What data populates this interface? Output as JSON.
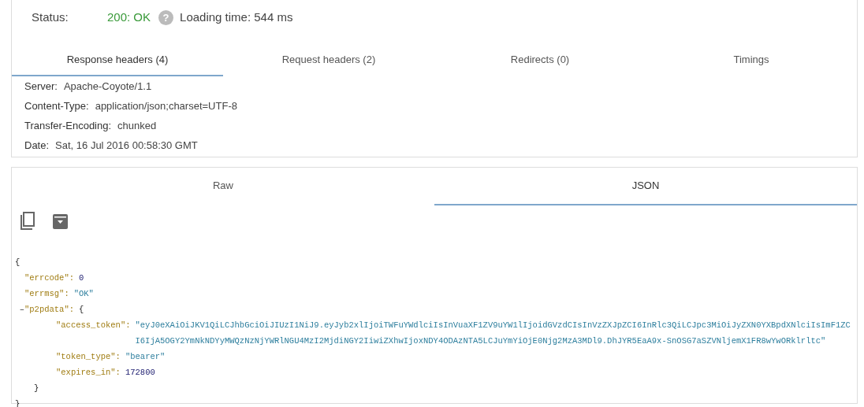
{
  "status": {
    "label": "Status:",
    "code": "200: OK",
    "help_icon": "?",
    "loading_time": "Loading time: 544 ms"
  },
  "header_tabs": [
    {
      "label": "Response headers (4)",
      "selected": true
    },
    {
      "label": "Request headers (2)",
      "selected": false
    },
    {
      "label": "Redirects (0)",
      "selected": false
    },
    {
      "label": "Timings",
      "selected": false
    }
  ],
  "headers": [
    {
      "name": "Server:",
      "value": "Apache-Coyote/1.1"
    },
    {
      "name": "Content-Type:",
      "value": "application/json;charset=UTF-8"
    },
    {
      "name": "Transfer-Encoding:",
      "value": "chunked"
    },
    {
      "name": "Date:",
      "value": "Sat, 16 Jul 2016 00:58:30 GMT"
    }
  ],
  "body_tabs": [
    {
      "label": "Raw",
      "selected": false
    },
    {
      "label": "JSON",
      "selected": true
    }
  ],
  "json_view": {
    "open": "{",
    "close": "}",
    "entries": [
      {
        "key": "\"errcode\":",
        "value": "0",
        "kind": "number"
      },
      {
        "key": "\"errmsg\":",
        "value": "\"OK\"",
        "kind": "string"
      },
      {
        "key": "\"p2pdata\":",
        "kind": "object",
        "toggle": "–",
        "expanded": true,
        "open": "{",
        "close": "}",
        "children": [
          {
            "key": "\"access_token\":",
            "value": "\"eyJ0eXAiOiJKV1QiLCJhbGciOiJIUzI1NiJ9.eyJyb2xlIjoiTWFuYWdlciIsInVuaXF1ZV9uYW1lIjoidGVzdCIsInVzZXJpZCI6InRlc3QiLCJpc3MiOiJyZXN0YXBpdXNlciIsImF1ZCI6IjA5OGY2YmNkNDYyMWQzNzNjYWRlNGU4MzI2MjdiNGY2IiwiZXhwIjoxNDY4ODAzNTA5LCJuYmYiOjE0Njg2MzA3MDl9.DhJYR5EaA9x-SnOSG7aSZVNljemX1FR8wYwORklrltc\"",
            "kind": "string"
          },
          {
            "key": "\"token_type\":",
            "value": "\"bearer\"",
            "kind": "string"
          },
          {
            "key": "\"expires_in\":",
            "value": "172800",
            "kind": "number"
          }
        ]
      }
    ]
  }
}
